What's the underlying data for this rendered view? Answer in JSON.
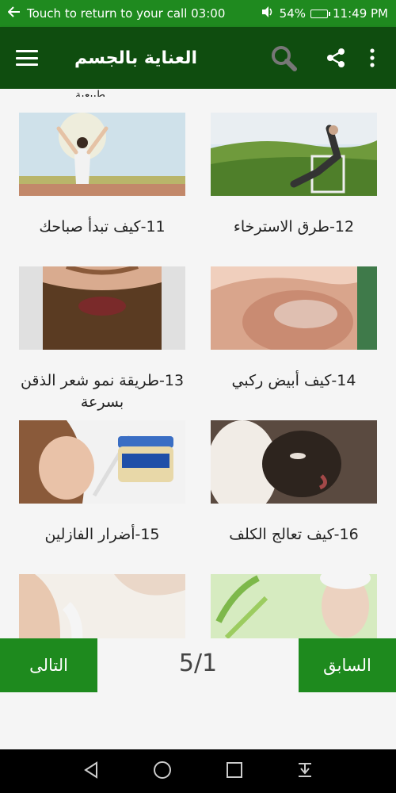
{
  "status": {
    "call_text": "Touch to return to your call 03:00",
    "battery": "54%",
    "time": "11:49 PM"
  },
  "app_bar": {
    "title": "العناية بالجسم"
  },
  "list": {
    "cut_title": "طبيعية",
    "items": [
      {
        "label": "12-طرق الاسترخاء"
      },
      {
        "label": "11-كيف تبدأ صباحك"
      },
      {
        "label": "14-كيف أبيض ركبي"
      },
      {
        "label": "13-طريقة نمو شعر الذقن بسرعة"
      },
      {
        "label": "16-كيف تعالج الكلف"
      },
      {
        "label": "15-أضرار الفازلين"
      }
    ]
  },
  "pager": {
    "prev_label": "السابق",
    "next_label": "التالى",
    "indicator": "5/1"
  },
  "colors": {
    "status_bar": "#1f8a1f",
    "app_bar": "#0f4d0f",
    "button": "#1e8a1e"
  }
}
